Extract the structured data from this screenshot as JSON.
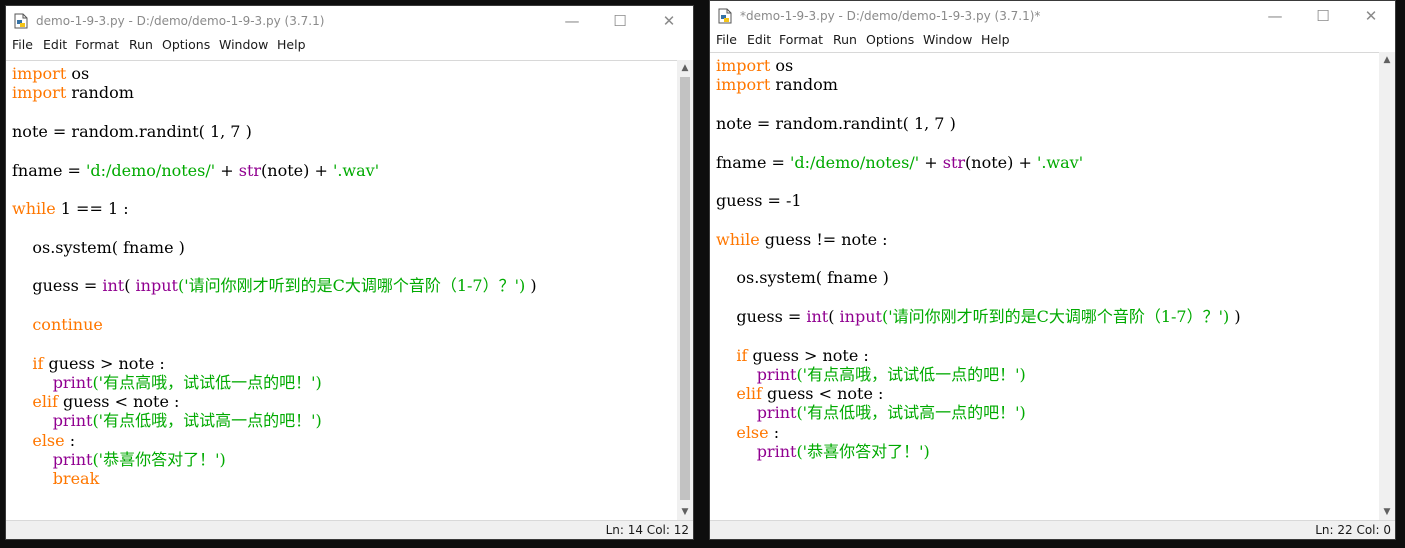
{
  "colors": {
    "keyword": "#ff7700",
    "builtin": "#900090",
    "string": "#00aa00",
    "default": "#000000"
  },
  "windows": [
    {
      "title": "demo-1-9-3.py - D:/demo/demo-1-9-3.py (3.7.1)",
      "menu": [
        "File",
        "Edit",
        "Format",
        "Run",
        "Options",
        "Window",
        "Help"
      ],
      "controls": {
        "minimize": "—",
        "maximize": "☐",
        "close": "✕"
      },
      "icon": "python-file-icon",
      "status": "Ln: 14  Col: 12",
      "code": [
        [
          [
            "kw",
            "import"
          ],
          [
            "n",
            " os"
          ]
        ],
        [
          [
            "kw",
            "import"
          ],
          [
            "n",
            " random"
          ]
        ],
        [],
        [
          [
            "n",
            "note = random.randint( 1, 7 )"
          ]
        ],
        [],
        [
          [
            "n",
            "fname = "
          ],
          [
            "st",
            "'d:/demo/notes/'"
          ],
          [
            "n",
            " + "
          ],
          [
            "bi",
            "str"
          ],
          [
            "n",
            "(note) + "
          ],
          [
            "st",
            "'.wav'"
          ]
        ],
        [],
        [
          [
            "kw",
            "while"
          ],
          [
            "n",
            " 1 == 1 :"
          ]
        ],
        [],
        [
          [
            "n",
            "    os.system( fname )"
          ]
        ],
        [],
        [
          [
            "n",
            "    guess = "
          ],
          [
            "bi",
            "int"
          ],
          [
            "n",
            "( "
          ],
          [
            "bi",
            "input"
          ],
          [
            "st",
            "('请问你刚才听到的是C大调哪个音阶（1-7）？')"
          ],
          [
            "n",
            " )"
          ]
        ],
        [],
        [
          [
            "n",
            "    "
          ],
          [
            "kw",
            "continue"
          ]
        ],
        [],
        [
          [
            "n",
            "    "
          ],
          [
            "kw",
            "if"
          ],
          [
            "n",
            " guess > note :"
          ]
        ],
        [
          [
            "n",
            "        "
          ],
          [
            "bi",
            "print"
          ],
          [
            "st",
            "('有点高哦，试试低一点的吧！')"
          ]
        ],
        [
          [
            "n",
            "    "
          ],
          [
            "kw",
            "elif"
          ],
          [
            "n",
            " guess < note :"
          ]
        ],
        [
          [
            "n",
            "        "
          ],
          [
            "bi",
            "print"
          ],
          [
            "st",
            "('有点低哦，试试高一点的吧！')"
          ]
        ],
        [
          [
            "n",
            "    "
          ],
          [
            "kw",
            "else"
          ],
          [
            "n",
            " :"
          ]
        ],
        [
          [
            "n",
            "        "
          ],
          [
            "bi",
            "print"
          ],
          [
            "st",
            "('恭喜你答对了！')"
          ]
        ],
        [
          [
            "n",
            "        "
          ],
          [
            "kw",
            "break"
          ]
        ]
      ]
    },
    {
      "title": "*demo-1-9-3.py - D:/demo/demo-1-9-3.py (3.7.1)*",
      "menu": [
        "File",
        "Edit",
        "Format",
        "Run",
        "Options",
        "Window",
        "Help"
      ],
      "controls": {
        "minimize": "—",
        "maximize": "☐",
        "close": "✕"
      },
      "icon": "python-file-icon",
      "status": "Ln: 22  Col: 0",
      "code": [
        [
          [
            "kw",
            "import"
          ],
          [
            "n",
            " os"
          ]
        ],
        [
          [
            "kw",
            "import"
          ],
          [
            "n",
            " random"
          ]
        ],
        [],
        [
          [
            "n",
            "note = random.randint( 1, 7 )"
          ]
        ],
        [],
        [
          [
            "n",
            "fname = "
          ],
          [
            "st",
            "'d:/demo/notes/'"
          ],
          [
            "n",
            " + "
          ],
          [
            "bi",
            "str"
          ],
          [
            "n",
            "(note) + "
          ],
          [
            "st",
            "'.wav'"
          ]
        ],
        [],
        [
          [
            "n",
            "guess = -1"
          ]
        ],
        [],
        [
          [
            "kw",
            "while"
          ],
          [
            "n",
            " guess != note :"
          ]
        ],
        [],
        [
          [
            "n",
            "    os.system( fname )"
          ]
        ],
        [],
        [
          [
            "n",
            "    guess = "
          ],
          [
            "bi",
            "int"
          ],
          [
            "n",
            "( "
          ],
          [
            "bi",
            "input"
          ],
          [
            "st",
            "('请问你刚才听到的是C大调哪个音阶（1-7）？')"
          ],
          [
            "n",
            " )"
          ]
        ],
        [],
        [
          [
            "n",
            "    "
          ],
          [
            "kw",
            "if"
          ],
          [
            "n",
            " guess > note :"
          ]
        ],
        [
          [
            "n",
            "        "
          ],
          [
            "bi",
            "print"
          ],
          [
            "st",
            "('有点高哦，试试低一点的吧！')"
          ]
        ],
        [
          [
            "n",
            "    "
          ],
          [
            "kw",
            "elif"
          ],
          [
            "n",
            " guess < note :"
          ]
        ],
        [
          [
            "n",
            "        "
          ],
          [
            "bi",
            "print"
          ],
          [
            "st",
            "('有点低哦，试试高一点的吧！')"
          ]
        ],
        [
          [
            "n",
            "    "
          ],
          [
            "kw",
            "else"
          ],
          [
            "n",
            " :"
          ]
        ],
        [
          [
            "n",
            "        "
          ],
          [
            "bi",
            "print"
          ],
          [
            "st",
            "('恭喜你答对了！')"
          ]
        ]
      ]
    }
  ]
}
